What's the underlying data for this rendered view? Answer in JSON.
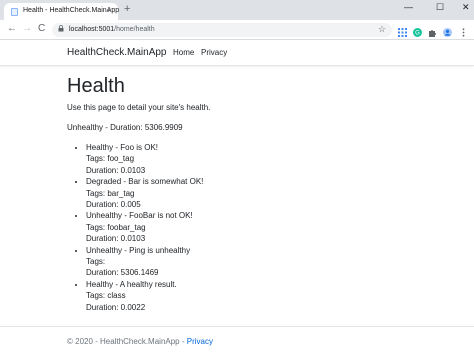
{
  "browser": {
    "tab_title": "Health - HealthCheck.MainApp",
    "tab_close": "×",
    "new_tab": "+",
    "window_controls": {
      "minimize": "—",
      "maximize": "☐",
      "close": "✕"
    },
    "nav": {
      "back": "←",
      "forward": "→",
      "reload": "C"
    },
    "url_host": "localhost:5001",
    "url_path": "/home/health",
    "icons": [
      "lock-icon",
      "star-icon",
      "extension-icon",
      "puzzle-icon",
      "profile-icon",
      "menu-icon"
    ]
  },
  "site": {
    "brand": "HealthCheck.MainApp",
    "nav_links": [
      "Home",
      "Privacy"
    ]
  },
  "page": {
    "heading": "Health",
    "intro": "Use this page to detail your site's health.",
    "overall": "Unhealthy - Duration: 5306.9909",
    "checks": [
      {
        "status_line": "Healthy - Foo is OK!",
        "tags": "Tags: foo_tag",
        "duration": "Duration: 0.0103"
      },
      {
        "status_line": "Degraded - Bar is somewhat OK!",
        "tags": "Tags: bar_tag",
        "duration": "Duration: 0.005"
      },
      {
        "status_line": "Unhealthy - FooBar is not OK!",
        "tags": "Tags: foobar_tag",
        "duration": "Duration: 0.0103"
      },
      {
        "status_line": "Unhealthy - Ping is unhealthy",
        "tags": "Tags:",
        "duration": "Duration: 5306.1469"
      },
      {
        "status_line": "Healthy - A healthy result.",
        "tags": "Tags: class",
        "duration": "Duration: 0.0022"
      }
    ]
  },
  "footer": {
    "text": "© 2020 - HealthCheck.MainApp - ",
    "link": "Privacy"
  },
  "colors": {
    "link": "#0366d6",
    "muted": "#6c757d",
    "text": "#212529"
  }
}
